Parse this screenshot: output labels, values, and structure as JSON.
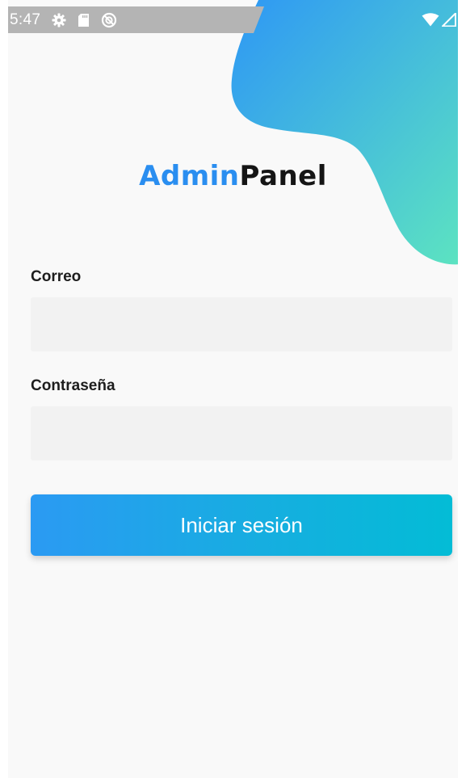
{
  "status_bar": {
    "time": "5:47",
    "icons": [
      "gear-icon",
      "sd-card-icon",
      "sync-icon",
      "wifi-icon",
      "signal-icon",
      "battery-icon"
    ]
  },
  "logo": {
    "part1": "Admin",
    "part2": "Panel"
  },
  "form": {
    "email_label": "Correo",
    "email_value": "",
    "password_label": "Contraseña",
    "password_value": "",
    "submit_label": "Iniciar sesión"
  },
  "colors": {
    "accent_blue": "#2a8ef0",
    "button_gradient_start": "#2b9af3",
    "button_gradient_end": "#03bcd6",
    "blob_gradient_start": "#2e97f5",
    "blob_gradient_end": "#5de4c0",
    "background": "#f9f9f9",
    "input_background": "#f2f2f2"
  }
}
